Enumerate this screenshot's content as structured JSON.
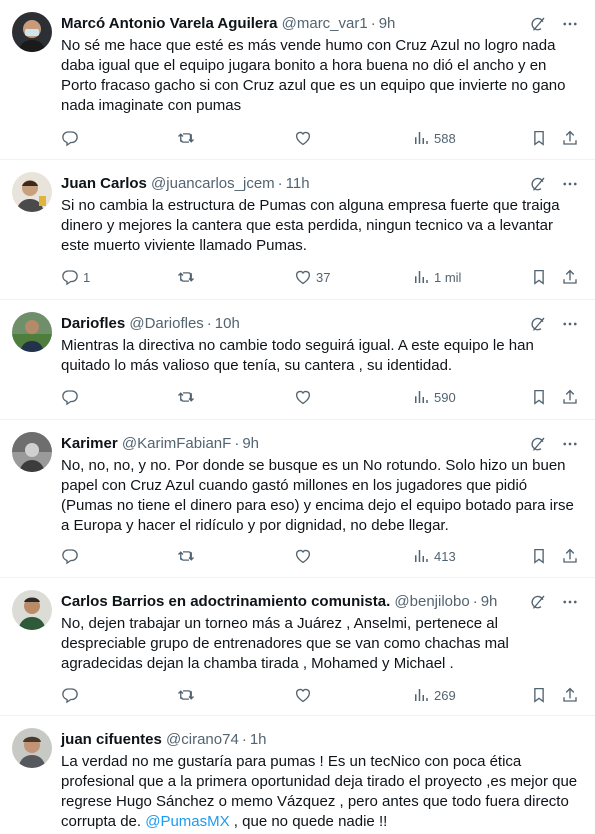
{
  "colors": {
    "text": "#0f1419",
    "secondary": "#536471",
    "link": "#1d9bf0",
    "divider": "#eff3f4"
  },
  "tweets": [
    {
      "name": "Marcó Antonio Varela Aguilera",
      "handle": "@marc_var1",
      "time": "9h",
      "text": "No sé me hace que esté es más vende humo con Cruz Azul no logro nada daba igual que el equipo jugara bonito a hora buena no dió el ancho y en Porto fracaso gacho si con Cruz azul que es un equipo que invierte no gano nada imaginate con pumas",
      "replies": "",
      "retweets": "",
      "likes": "",
      "views": "588"
    },
    {
      "name": "Juan Carlos",
      "handle": "@juancarlos_jcem",
      "time": "11h",
      "text": "Si no cambia la estructura de Pumas con alguna empresa fuerte que traiga dinero y mejores la cantera que esta perdida, ningun tecnico va a levantar este muerto viviente llamado Pumas.",
      "replies": "1",
      "retweets": "",
      "likes": "37",
      "views": "1 mil"
    },
    {
      "name": "Dariofles",
      "handle": "@Dariofles",
      "time": "10h",
      "text": "Mientras la directiva no cambie todo seguirá igual. A este equipo le han quitado lo más valioso que tenía, su cantera , su identidad.",
      "replies": "",
      "retweets": "",
      "likes": "",
      "views": "590"
    },
    {
      "name": "Karimer",
      "handle": "@KarimFabianF",
      "time": "9h",
      "text": "No, no, no, y no. Por donde se busque es un No rotundo. Solo hizo un buen papel con Cruz Azul cuando gastó millones en los jugadores que pidió (Pumas no tiene el dinero para eso) y encima dejo el equipo botado para irse a Europa y hacer el ridículo y por dignidad, no debe llegar.",
      "replies": "",
      "retweets": "",
      "likes": "",
      "views": "413"
    },
    {
      "name": "Carlos Barrios en adoctrinamiento comunista.",
      "handle": "@benjilobo",
      "time": "9h",
      "text": "No, dejen trabajar un torneo más a Juárez ,  Anselmi, pertenece al despreciable grupo de entrenadores que se van como chachas mal agradecidas dejan la chamba tirada , Mohamed y Michael .",
      "replies": "",
      "retweets": "",
      "likes": "",
      "views": "269"
    },
    {
      "name": "juan cifuentes",
      "handle": "@cirano74",
      "time": "1h",
      "text": "La verdad no me gustaría para pumas ! Es un tecNico con poca ética profesional que a la primera oportunidad deja tirado el proyecto ,es mejor que regrese Hugo Sánchez o memo Vázquez , pero antes que todo fuera directo corrupta de. ",
      "mention": "@PumasMX",
      "text_after": " , que no quede nadie !!",
      "replies": "",
      "retweets": "",
      "likes": "",
      "views": ""
    }
  ]
}
